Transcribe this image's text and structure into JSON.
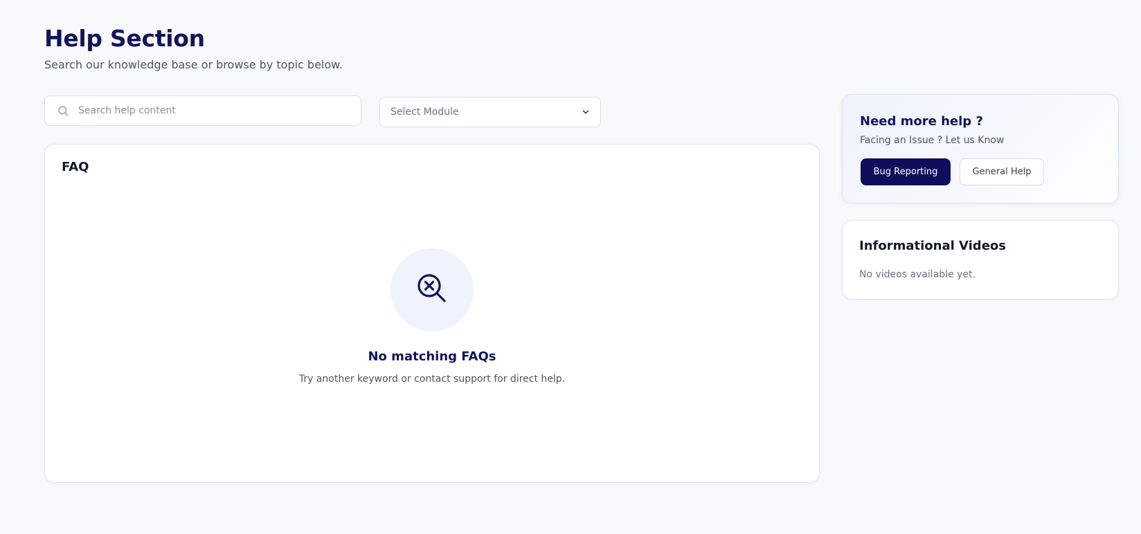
{
  "header": {
    "title": "Help Section",
    "subtitle": "Search our knowledge base or browse by topic below."
  },
  "search": {
    "placeholder": "Search help content",
    "value": "",
    "icon": "search-icon"
  },
  "module_select": {
    "selected_label": "Select Module",
    "icon": "chevron-down-icon"
  },
  "faq": {
    "title": "FAQ",
    "empty_state": {
      "icon": "search-x-icon",
      "title": "No matching FAQs",
      "message": "Try another keyword or contact support for direct help."
    }
  },
  "help_card": {
    "title": "Need more help ?",
    "subtitle": "Facing an Issue ? Let us Know",
    "primary_button": "Bug Reporting",
    "secondary_button": "General Help"
  },
  "videos": {
    "title": "Informational Videos",
    "empty_message": "No videos available yet."
  },
  "colors": {
    "background": "#f8f9fb",
    "primary": "#0e0e5c",
    "heading": "#12145a",
    "empty_circle": "#eef3fd"
  }
}
